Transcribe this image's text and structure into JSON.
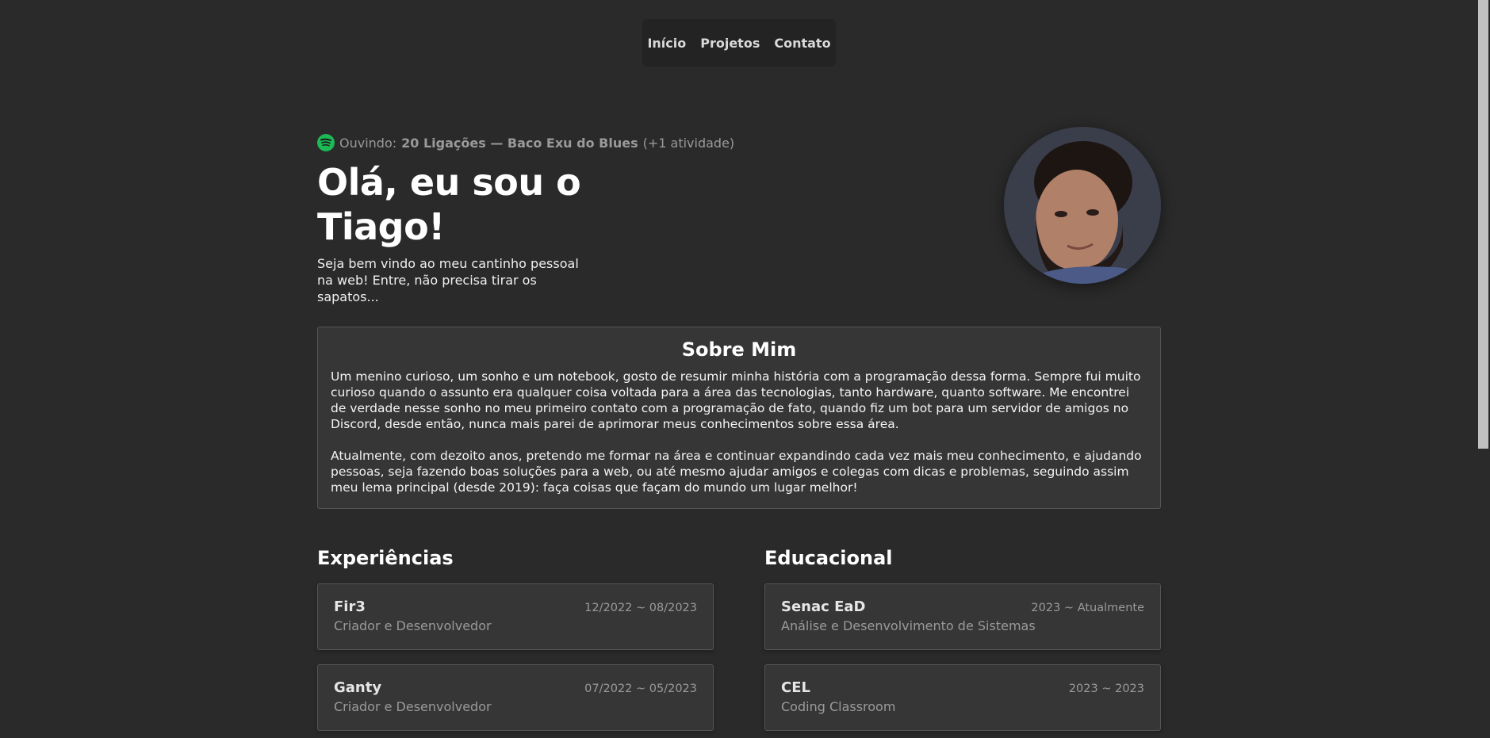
{
  "nav": {
    "items": [
      "Início",
      "Projetos",
      "Contato"
    ]
  },
  "now_playing": {
    "prefix": "Ouvindo:",
    "track": "20 Ligações — Baco Exu do Blues",
    "suffix": "(+1 atividade)",
    "icon": "spotify-icon",
    "icon_color": "#1db954"
  },
  "hero": {
    "title": "Olá, eu sou o Tiago!",
    "subtitle": "Seja bem vindo ao meu cantinho pessoal na web! Entre, não precisa tirar os sapatos..."
  },
  "about": {
    "title": "Sobre Mim",
    "paragraphs": [
      "Um menino curioso, um sonho e um notebook, gosto de resumir minha história com a programação dessa forma. Sempre fui muito curioso quando o assunto era qualquer coisa voltada para a área das tecnologias, tanto hardware, quanto software. Me encontrei de verdade nesse sonho no meu primeiro contato com a programação de fato, quando fiz um bot para um servidor de amigos no Discord, desde então, nunca mais parei de aprimorar meus conhecimentos sobre essa área.",
      "Atualmente, com dezoito anos, pretendo me formar na área e continuar expandindo cada vez mais meu conhecimento, e ajudando pessoas, seja fazendo boas soluções para a web, ou até mesmo ajudar amigos e colegas com dicas e problemas, seguindo assim meu lema principal (desde 2019): faça coisas que façam do mundo um lugar melhor!"
    ]
  },
  "experiences": {
    "title": "Experiências",
    "items": [
      {
        "name": "Fir3",
        "role": "Criador e Desenvolvedor",
        "date": "12/2022 ~ 08/2023"
      },
      {
        "name": "Ganty",
        "role": "Criador e Desenvolvedor",
        "date": "07/2022 ~ 05/2023"
      }
    ]
  },
  "education": {
    "title": "Educacional",
    "items": [
      {
        "name": "Senac EaD",
        "role": "Análise e Desenvolvimento de Sistemas",
        "date": "2023 ~ Atualmente"
      },
      {
        "name": "CEL",
        "role": "Coding Classroom",
        "date": "2023 ~ 2023"
      }
    ]
  },
  "colors": {
    "background": "#2a2a2a",
    "card": "#363636",
    "border": "#555555",
    "muted_text": "#9a9a9a"
  }
}
